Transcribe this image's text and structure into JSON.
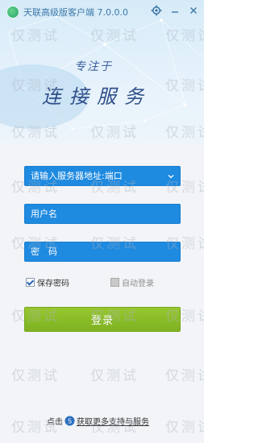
{
  "window": {
    "title": "天联高级版客户端 7.0.0.0"
  },
  "banner": {
    "slogan_small": "专注于",
    "slogan_main": "连接服务"
  },
  "form": {
    "server_placeholder": "请输入服务器地址:端口",
    "username_placeholder": "用户名",
    "password_placeholder": "密　码",
    "save_password_label": "保存密码",
    "save_password_checked": true,
    "auto_login_label": "自动登录",
    "auto_login_checked": false,
    "login_label": "登录"
  },
  "footer": {
    "prefix": "点击",
    "link_text": "获取更多支持与服务"
  },
  "watermark": {
    "text": "仅测试"
  },
  "colors": {
    "field_blue": "#1e8ae0",
    "login_green": "#8cbf2a",
    "banner_bg": "#dcecf8"
  },
  "icons": {
    "app_logo": "app-logo-icon",
    "settings": "gear-icon",
    "minimize": "minimize-icon",
    "close": "close-icon",
    "dropdown": "chevron-down-icon",
    "support": "support-icon"
  }
}
